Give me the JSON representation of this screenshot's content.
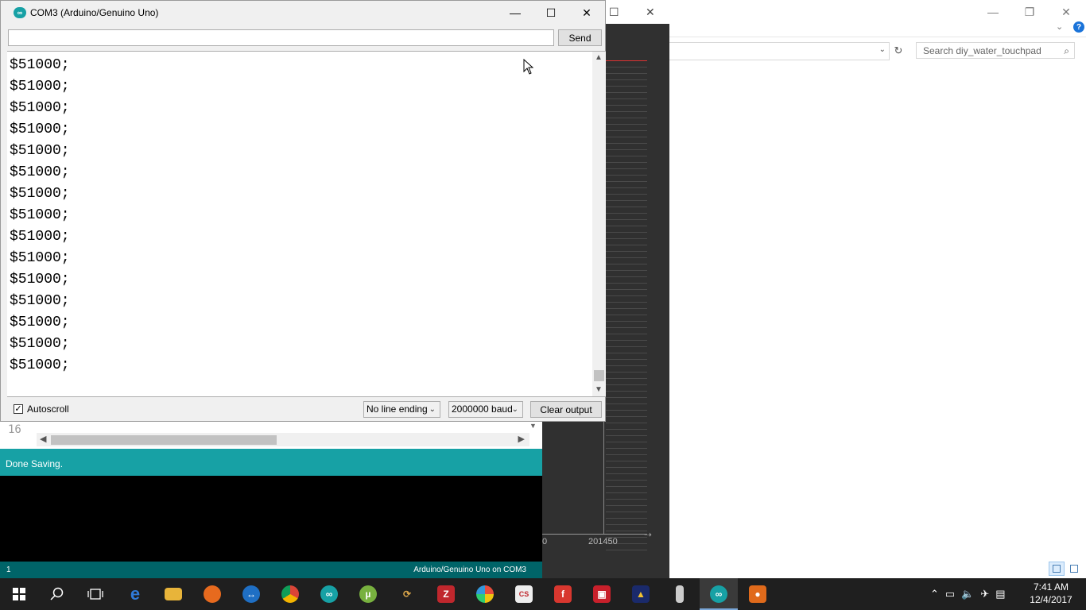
{
  "serial_monitor": {
    "title": "COM3 (Arduino/Genuino Uno)",
    "input_value": "",
    "send_label": "Send",
    "output_lines": [
      "$51000;",
      "$51000;",
      "$51000;",
      "$51000;",
      "$51000;",
      "$51000;",
      "$51000;",
      "$51000;",
      "$51000;",
      "$51000;",
      "$51000;",
      "$51000;",
      "$51000;",
      "$51000;",
      "$51000;"
    ],
    "autoscroll_label": "Autoscroll",
    "autoscroll_checked": true,
    "line_ending": "No line ending",
    "baud_rate": "2000000 baud",
    "clear_label": "Clear output"
  },
  "ide": {
    "line_number": "16",
    "status_message": "Done Saving.",
    "footer_line": "1",
    "footer_board": "Arduino/Genuino Uno on COM3"
  },
  "plotter": {
    "x_tick_partial": "0",
    "x_tick": "201450"
  },
  "explorer": {
    "search_placeholder": "Search diy_water_touchpad"
  },
  "clock": {
    "time": "7:41 AM",
    "date": "12/4/2017"
  },
  "colors": {
    "arduino_teal": "#17a1a5",
    "footer_teal": "#006468",
    "taskbar": "#1f1f1f"
  },
  "taskbar_icons": [
    "windows-start-icon",
    "search-icon",
    "task-view-icon",
    "edge-icon",
    "file-explorer-icon",
    "firefox-icon",
    "teamviewer-icon",
    "chrome-icon",
    "arduino-icon",
    "utorrent-icon",
    "app-icon",
    "filezilla-icon",
    "picasa-icon",
    "eagle-icon",
    "foxit-icon",
    "app-red-icon",
    "app-yellow-icon",
    "usb-icon",
    "arduino-active-icon",
    "app-orange-icon"
  ]
}
